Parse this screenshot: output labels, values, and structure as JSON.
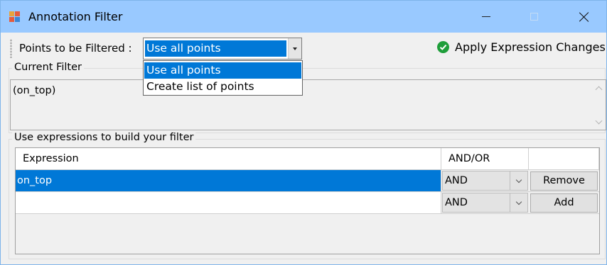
{
  "window": {
    "title": "Annotation Filter",
    "accent_color": "#99c9ff",
    "selection_color": "#0078d7"
  },
  "toolbar": {
    "points_label": "Points to be Filtered :",
    "points_selected": "Use all points",
    "apply_label": "Apply Expression Changes",
    "apply_icon": "check-circle-icon"
  },
  "dropdown": {
    "options": [
      "Use all points",
      "Create list of points"
    ],
    "selected_index": 0
  },
  "current_filter": {
    "title": "Current Filter",
    "text": "(on_top)"
  },
  "expressions": {
    "title": "Use expressions to build your filter",
    "headers": [
      "Expression",
      "AND/OR",
      ""
    ],
    "rows": [
      {
        "expression": "on_top",
        "andor": "AND",
        "button": "Remove",
        "selected": true
      },
      {
        "expression": "",
        "andor": "AND",
        "button": "Add",
        "selected": false
      }
    ]
  }
}
